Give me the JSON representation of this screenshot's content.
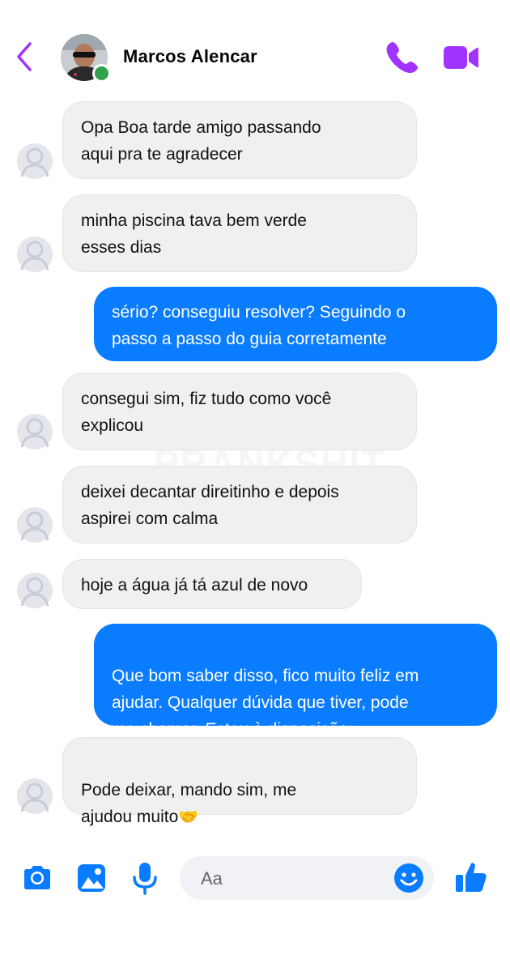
{
  "header": {
    "contact_name": "Marcos Alencar",
    "back_icon": "chevron-left-icon",
    "call_icon": "phone-icon",
    "video_icon": "video-camera-icon",
    "accent_color": "#a033ff",
    "online_color": "#31a24c"
  },
  "messages": [
    {
      "side": "in",
      "text": "Opa Boa tarde amigo passando\naqui pra te agradecer"
    },
    {
      "side": "in",
      "text": "minha piscina tava bem verde\nesses dias"
    },
    {
      "side": "out",
      "text": "sério? conseguiu resolver? Seguindo o\npasso a passo do guia corretamente"
    },
    {
      "side": "in",
      "text": "consegui sim, fiz tudo como você\nexplicou"
    },
    {
      "side": "in",
      "text": "deixei decantar direitinho e depois\naspirei com calma"
    },
    {
      "side": "in",
      "text": "hoje a água já tá azul de novo"
    },
    {
      "side": "out",
      "text": "Que bom saber disso, fico muito feliz em\najudar. Qualquer dúvida que tiver, pode\nme chamar. Estou à disposição.",
      "emoji": "😊"
    },
    {
      "side": "in",
      "text": "Pode deixar, mando sim, me\najudou muito",
      "emoji": "🤝"
    }
  ],
  "watermark": "PRANKSHIT",
  "composer": {
    "placeholder": "Aa",
    "value": "",
    "camera_icon": "camera-icon",
    "gallery_icon": "image-icon",
    "mic_icon": "microphone-icon",
    "emoji_icon": "smiley-icon",
    "like_icon": "thumbs-up-icon",
    "accent_color": "#0a7cff"
  }
}
